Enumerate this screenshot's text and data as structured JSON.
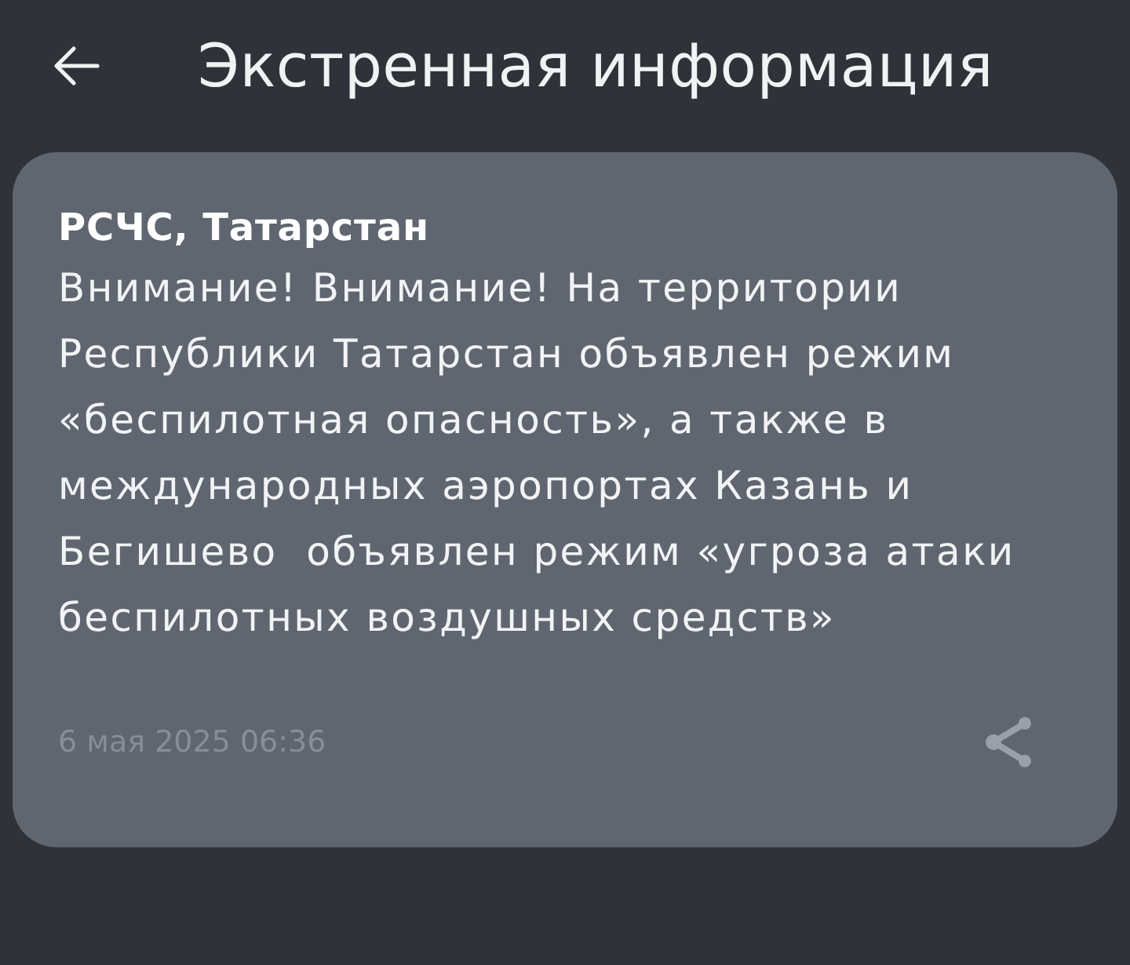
{
  "header": {
    "title": "Экстренная информация"
  },
  "alert": {
    "source": "РСЧС, Татарстан",
    "message": "Внимание! Внимание! На территории Республики Татарстан объявлен режим «беспилотная опасность», а также в международных аэропортах Казань и Бегишево  объявлен режим «угроза атаки беспилотных воздушных средств»",
    "timestamp": "6 мая 2025 06:36"
  }
}
